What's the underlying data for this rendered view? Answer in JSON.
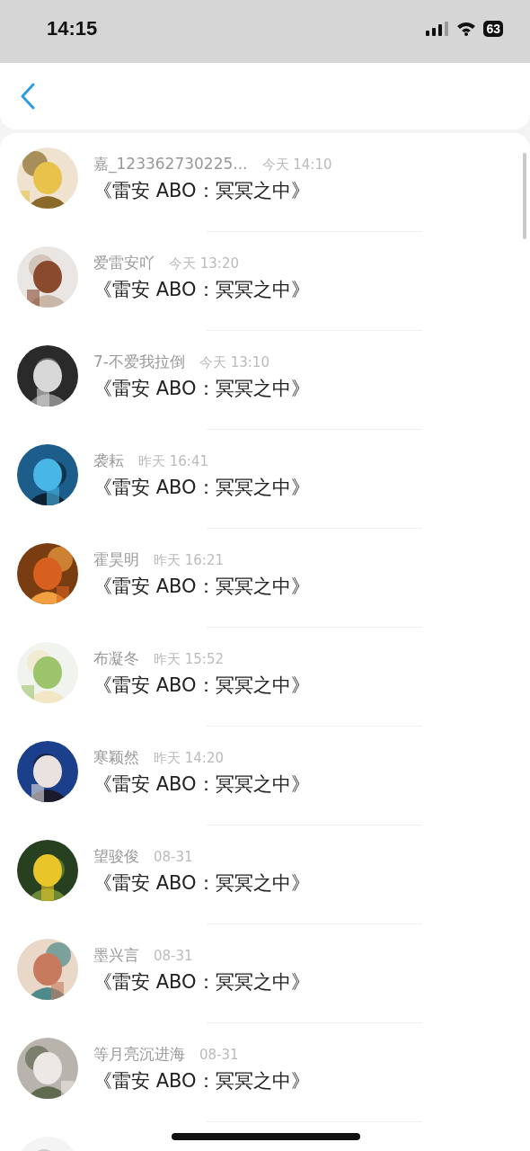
{
  "status_bar": {
    "time": "14:15",
    "battery": "63"
  },
  "messages": [
    {
      "name": "嘉_123362730225...",
      "time": "今天 14:10",
      "title": "《雷安 ABO：冥冥之中》"
    },
    {
      "name": "爱雷安吖",
      "time": "今天 13:20",
      "title": "《雷安 ABO：冥冥之中》"
    },
    {
      "name": "7-不爱我拉倒",
      "time": "今天 13:10",
      "title": "《雷安 ABO：冥冥之中》"
    },
    {
      "name": "袭耘",
      "time": "昨天 16:41",
      "title": "《雷安 ABO：冥冥之中》"
    },
    {
      "name": "霍昊明",
      "time": "昨天 16:21",
      "title": "《雷安 ABO：冥冥之中》"
    },
    {
      "name": "布凝冬",
      "time": "昨天 15:52",
      "title": "《雷安 ABO：冥冥之中》"
    },
    {
      "name": "寒颖然",
      "time": "昨天 14:20",
      "title": "《雷安 ABO：冥冥之中》"
    },
    {
      "name": "望骏俊",
      "time": "08-31",
      "title": "《雷安 ABO：冥冥之中》"
    },
    {
      "name": "墨兴言",
      "time": "08-31",
      "title": "《雷安 ABO：冥冥之中》"
    },
    {
      "name": "等月亮沉进海",
      "time": "08-31",
      "title": "《雷安 ABO：冥冥之中》"
    }
  ]
}
